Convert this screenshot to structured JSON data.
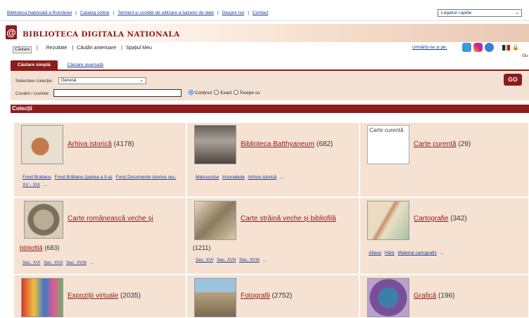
{
  "topbar": {
    "links": [
      "Biblioteca Națională a României",
      "Catalog online",
      "Termeni și condiții de utilizare a bazelor de date",
      "Despre noi",
      "Contact"
    ],
    "quick_links_value": "Legaturi rapide"
  },
  "brand": {
    "logo_mark": "@",
    "title": "BIBLIOTECA DIGITALA NATIONALA"
  },
  "nav": {
    "active": "Căutare",
    "items": [
      "Rezultate",
      "Căutări anterioare",
      "Spațiul Meu"
    ],
    "follow_label": "Urmăriți-ne și pe:",
    "social_icons": [
      "twitter-icon",
      "instagram-icon",
      "facebook-icon"
    ],
    "flag_colors": [
      "#002b7f",
      "#fcd116",
      "#ce1126"
    ],
    "user_hint": "Gu"
  },
  "search": {
    "tabs": [
      "Căutare simplă",
      "Căutare avansată"
    ],
    "collection_label": "Selectare colecție:",
    "collection_value": "General",
    "words_label": "Cuvânt / cuvinte:",
    "words_value": "",
    "radio_options": [
      "Conținut",
      "Exact",
      "Începe cu"
    ],
    "radio_selected": 0,
    "go_label": "GO"
  },
  "collections": {
    "heading": "Colecții",
    "items": [
      {
        "title": "Arhiva istorică",
        "count": "(4178)",
        "subs": [
          "Fond Bratianu",
          "Fond Brătianu (partea a II-a)",
          "Fond Documente istorice sec. XV - XIX"
        ],
        "more": "..."
      },
      {
        "title": "Biblioteca Batthyaneum",
        "count": "(682)",
        "subs": [
          "Manuscrise",
          "Incunabule",
          "Arhiva istorică"
        ],
        "more": "..."
      },
      {
        "title": "Carte curentă",
        "count": "(29)",
        "subs": [],
        "more": "",
        "broken_alt": "Carte curentă"
      },
      {
        "title": "Carte românească veche și",
        "title_cont": "bibliofilă",
        "count": "(683)",
        "subs": [
          "Sec. XVI",
          "Sec. XVII",
          "Sec. XVIII"
        ],
        "more": "..."
      },
      {
        "title": "Carte străină veche și bibliofilă",
        "count": "(1211)",
        "subs": [
          "Sec. XVI",
          "Sec. XVII",
          "Sec. XVIII"
        ],
        "more": "..."
      },
      {
        "title": "Cartografie",
        "count": "(342)",
        "subs": [
          "Atlase",
          "Hărți",
          "Material cartografic"
        ],
        "more": "..."
      },
      {
        "title": "Expoziții virtuale",
        "count": "(2035)",
        "subs": [],
        "more": ""
      },
      {
        "title": "Fotografii",
        "count": "(2752)",
        "subs": [],
        "more": ""
      },
      {
        "title": "Grafică",
        "count": "(196)",
        "subs": [],
        "more": ""
      }
    ]
  }
}
